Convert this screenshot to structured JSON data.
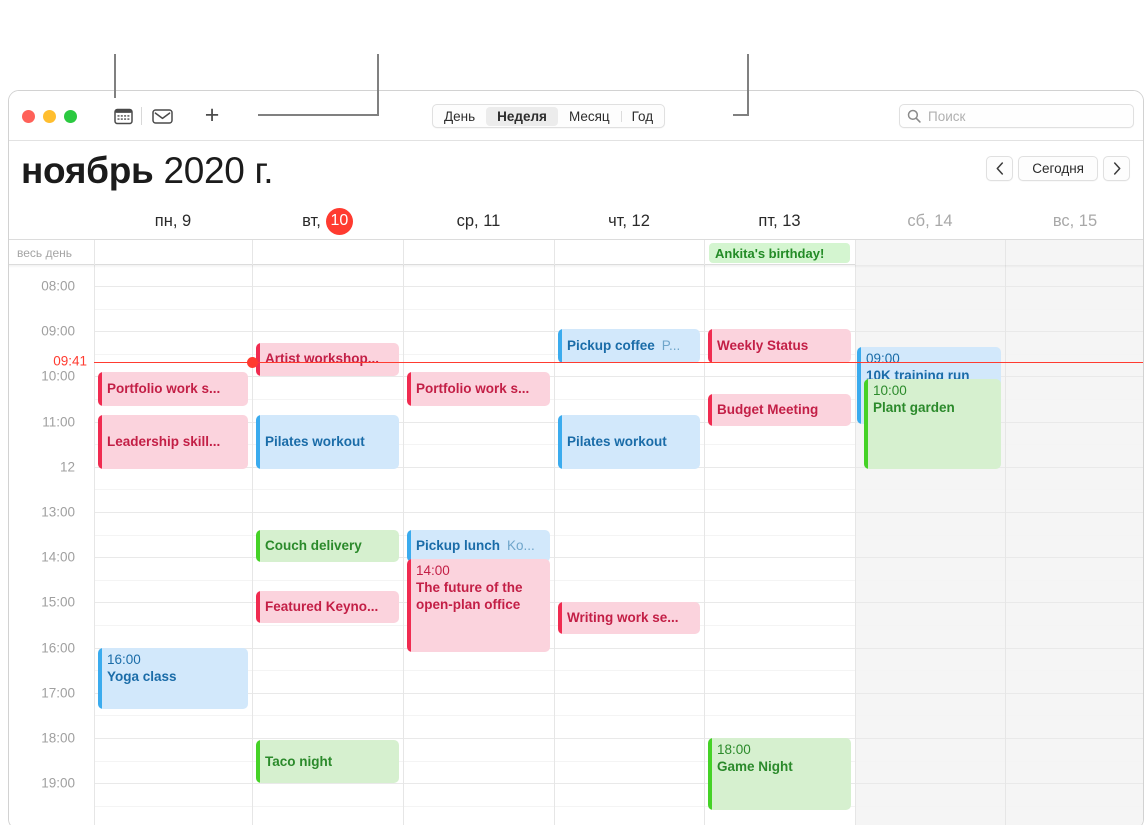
{
  "window": {
    "traffic_lights": [
      "close",
      "minimize",
      "zoom"
    ],
    "toolbar": {
      "calendar_icon": "calendar-icon",
      "inbox_icon": "inbox-icon",
      "add_label": "+",
      "views": [
        {
          "label": "День",
          "active": false
        },
        {
          "label": "Неделя",
          "active": true
        },
        {
          "label": "Месяц",
          "active": false
        },
        {
          "label": "Год",
          "active": false
        }
      ],
      "search": {
        "icon": "search-icon",
        "placeholder": "Поиск",
        "value": ""
      }
    }
  },
  "header": {
    "month": "ноябрь",
    "year": "2020 г.",
    "nav": {
      "prev": "‹",
      "today": "Сегодня",
      "next": "›"
    }
  },
  "grid": {
    "allday_label": "весь день",
    "days": [
      {
        "label": "пн, 9",
        "num": "9",
        "today": false,
        "weekend": false
      },
      {
        "label": "вт, ",
        "num": "10",
        "today": true,
        "weekend": false
      },
      {
        "label": "ср, 11",
        "num": "11",
        "today": false,
        "weekend": false
      },
      {
        "label": "чт, 12",
        "num": "12",
        "today": false,
        "weekend": false
      },
      {
        "label": "пт, 13",
        "num": "13",
        "today": false,
        "weekend": false
      },
      {
        "label": "сб, 14",
        "num": "14",
        "today": false,
        "weekend": true
      },
      {
        "label": "вс, 15",
        "num": "15",
        "today": false,
        "weekend": true
      }
    ],
    "time_labels": [
      "08:00",
      "09:00",
      "10:00",
      "11:00",
      "12",
      "13:00",
      "14:00",
      "15:00",
      "16:00",
      "17:00",
      "18:00",
      "19:00"
    ],
    "now": {
      "label": "09:41",
      "color": "#ff3b30"
    }
  },
  "allday_events": [
    {
      "title": "Ankita's birthday!",
      "day": 4,
      "color": "green"
    }
  ],
  "events": [
    {
      "title": "Portfolio work s...",
      "time": "",
      "day": 0,
      "color": "pink",
      "compact": true
    },
    {
      "title": "Leadership skill...",
      "time": "",
      "day": 0,
      "color": "pink",
      "compact": true
    },
    {
      "title": "16:00",
      "time": "16:00",
      "day": 0,
      "color": "blue",
      "compact": false,
      "name": "Yoga class"
    },
    {
      "title": "Artist workshop...",
      "time": "",
      "day": 1,
      "color": "pink",
      "compact": true
    },
    {
      "title": "Pilates workout",
      "time": "",
      "day": 1,
      "color": "blue",
      "compact": true
    },
    {
      "title": "Couch delivery",
      "time": "",
      "day": 1,
      "color": "green",
      "compact": true
    },
    {
      "title": "Featured Keyno...",
      "time": "",
      "day": 1,
      "color": "pink",
      "compact": true
    },
    {
      "title": "Taco night",
      "time": "",
      "day": 1,
      "color": "green",
      "compact": true
    },
    {
      "title": "Portfolio work s...",
      "time": "",
      "day": 2,
      "color": "pink",
      "compact": true
    },
    {
      "title": "Pickup lunch",
      "time": "",
      "day": 2,
      "color": "blue",
      "compact": true,
      "sub": "Ko..."
    },
    {
      "title": "The future of the open-plan office",
      "time": "14:00",
      "day": 2,
      "color": "pink",
      "compact": false
    },
    {
      "title": "Pickup coffee",
      "time": "",
      "day": 3,
      "color": "blue",
      "compact": true,
      "sub": "P..."
    },
    {
      "title": "Pilates workout",
      "time": "",
      "day": 3,
      "color": "blue",
      "compact": true
    },
    {
      "title": "Writing work se...",
      "time": "",
      "day": 3,
      "color": "pink",
      "compact": true
    },
    {
      "title": "Weekly Status",
      "time": "",
      "day": 4,
      "color": "pink",
      "compact": true
    },
    {
      "title": "Budget Meeting",
      "time": "",
      "day": 4,
      "color": "pink",
      "compact": true
    },
    {
      "title": "Game Night",
      "time": "18:00",
      "day": 4,
      "color": "green",
      "compact": false
    },
    {
      "title": "10K training run",
      "time": "09:00",
      "day": 5,
      "color": "blue",
      "compact": false
    },
    {
      "title": "Plant garden",
      "time": "10:00",
      "day": 5,
      "color": "green",
      "compact": false
    }
  ],
  "event_labels": {
    "e0": {
      "title": "Portfolio work s...",
      "time": ""
    },
    "e1": {
      "title": "Leadership skill...",
      "time": ""
    },
    "e2": {
      "title": "Yoga class",
      "time": "16:00"
    },
    "e3": {
      "title": "Artist workshop...",
      "time": ""
    },
    "e4": {
      "title": "Pilates workout",
      "time": ""
    },
    "e5": {
      "title": "Couch delivery",
      "time": ""
    },
    "e6": {
      "title": "Featured Keyno...",
      "time": ""
    },
    "e7": {
      "title": "Taco night",
      "time": ""
    },
    "e8": {
      "title": "Portfolio work s...",
      "time": ""
    },
    "e9": {
      "title": "Pickup lunch",
      "sub": "Ko...",
      "time": ""
    },
    "e10": {
      "title": "The future of the",
      "title2": "open-plan office",
      "time": "14:00"
    },
    "e11": {
      "title": "Pickup coffee",
      "sub": "P...",
      "time": ""
    },
    "e12": {
      "title": "Pilates workout",
      "time": ""
    },
    "e13": {
      "title": "Writing work se...",
      "time": ""
    },
    "e14": {
      "title": "Weekly Status",
      "time": ""
    },
    "e15": {
      "title": "Budget Meeting",
      "time": ""
    },
    "e16": {
      "title": "Game Night",
      "time": "18:00"
    },
    "e17": {
      "title": "10K training run",
      "time": "09:00"
    },
    "e18": {
      "title": "Plant garden",
      "time": "10:00"
    }
  },
  "colors": {
    "accent_red": "#ff3b30",
    "pink_bg": "#fbd3dd",
    "pink_bar": "#f02b50",
    "blue_bg": "#d2e8fb",
    "blue_bar": "#3aabee",
    "green_bg": "#d6f0cf",
    "green_bar": "#45d226",
    "weekend_bg": "#f5f5f5"
  }
}
